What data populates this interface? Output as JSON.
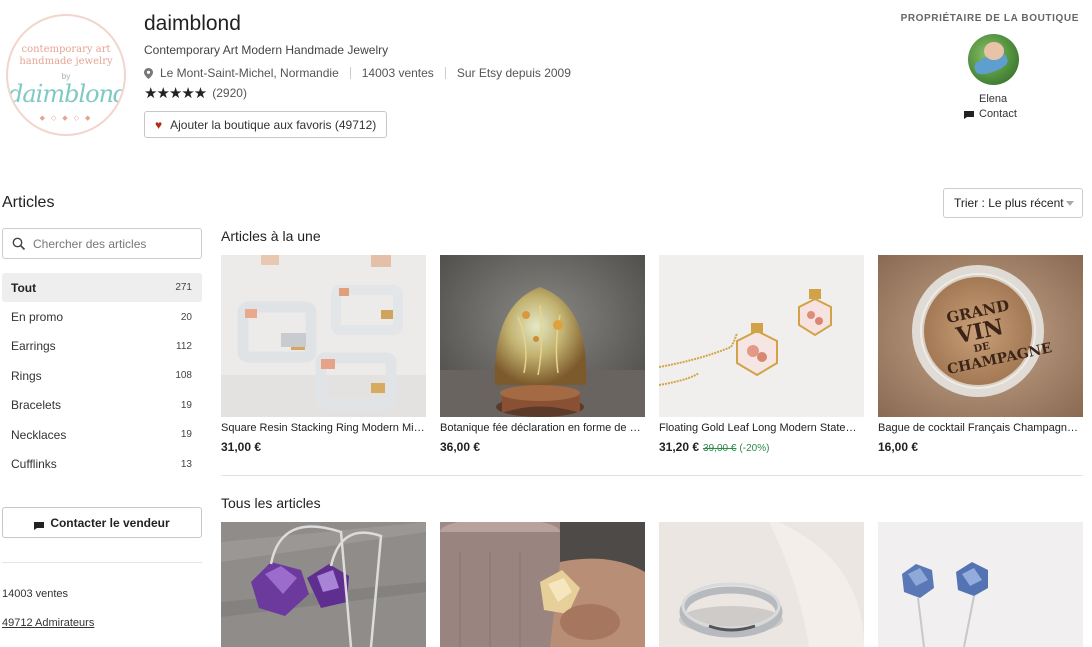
{
  "shop": {
    "logo_top_line1": "contemporary art",
    "logo_top_line2": "handmade jewelry",
    "logo_by": "by",
    "logo_main": "daimblond",
    "name": "daimblond",
    "tagline": "Contemporary Art Modern Handmade Jewelry",
    "location": "Le Mont-Saint-Michel, Normandie",
    "sales": "14003 ventes",
    "since": "Sur Etsy depuis 2009",
    "stars": "★★★★★",
    "reviews": "(2920)",
    "favorite_label": "Ajouter la boutique aux favoris (49712)"
  },
  "owner": {
    "label": "PROPRIÉTAIRE DE LA BOUTIQUE",
    "name": "Elena",
    "contact_label": "Contact"
  },
  "sidebar": {
    "title": "Articles",
    "search_placeholder": "Chercher des articles",
    "categories": [
      {
        "label": "Tout",
        "count": "271"
      },
      {
        "label": "En promo",
        "count": "20"
      },
      {
        "label": "Earrings",
        "count": "112"
      },
      {
        "label": "Rings",
        "count": "108"
      },
      {
        "label": "Bracelets",
        "count": "19"
      },
      {
        "label": "Necklaces",
        "count": "19"
      },
      {
        "label": "Cufflinks",
        "count": "13"
      }
    ],
    "contact_seller": "Contacter le vendeur",
    "sales_count": "14003 ventes",
    "admirers": "49712 Admirateurs"
  },
  "main": {
    "sort_label": "Trier : Le plus récent",
    "featured_title": "Articles à la une",
    "all_title": "Tous les articles",
    "featured": [
      {
        "title": "Square Resin Stacking Ring Modern Minimalist Jewelry",
        "price": "31,00 €"
      },
      {
        "title": "Botanique fée déclaration en forme de dôme",
        "price": "36,00 €"
      },
      {
        "title": "Floating Gold Leaf Long Modern Statement Necklace",
        "price": "31,20 €",
        "old_price": "39,00 €",
        "discount": "(-20%)"
      },
      {
        "title": "Bague de cocktail Français Champagne Vin",
        "price": "16,00 €"
      }
    ]
  },
  "colors": {
    "accent_heart": "#b5291c",
    "discount_green": "#2c8a4a",
    "logo_teal": "#7fc9c4",
    "logo_peach": "#e4a593"
  }
}
